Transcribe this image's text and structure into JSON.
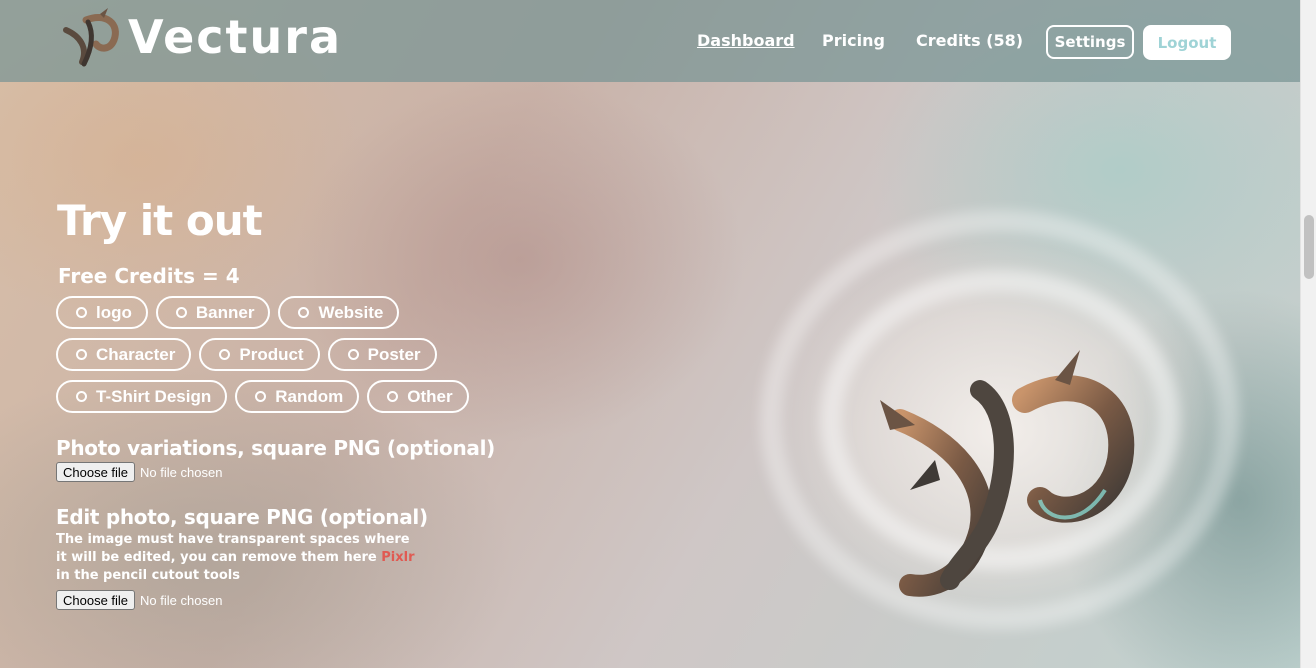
{
  "header": {
    "brand": "Vectura",
    "nav": {
      "dashboard": "Dashboard",
      "pricing": "Pricing",
      "credits": "Credits (58)"
    },
    "settings_label": "Settings",
    "logout_label": "Logout"
  },
  "main": {
    "title": "Try it out",
    "free_credits": "Free Credits = 4",
    "categories": [
      [
        "logo",
        "Banner",
        "Website"
      ],
      [
        "Character",
        "Product",
        "Poster"
      ],
      [
        "T-Shirt Design",
        "Random",
        "Other"
      ]
    ],
    "photo_variations": {
      "title": "Photo variations, square PNG (optional)",
      "button": "Choose file",
      "status": "No file chosen"
    },
    "edit_photo": {
      "title": "Edit photo, square PNG (optional)",
      "help_before": "The image must have transparent spaces where it will be edited, you can remove them here ",
      "help_link": "Pixlr",
      "help_after": " in the pencil cutout tools",
      "button": "Choose file",
      "status": "No file chosen"
    }
  },
  "colors": {
    "header_bg": "#7a9494",
    "logout_text": "#9fd3d6",
    "link_accent": "#e05a52"
  },
  "icons": {
    "brand_logo": "vectura-logo-icon",
    "radio": "radio-unchecked-icon"
  }
}
